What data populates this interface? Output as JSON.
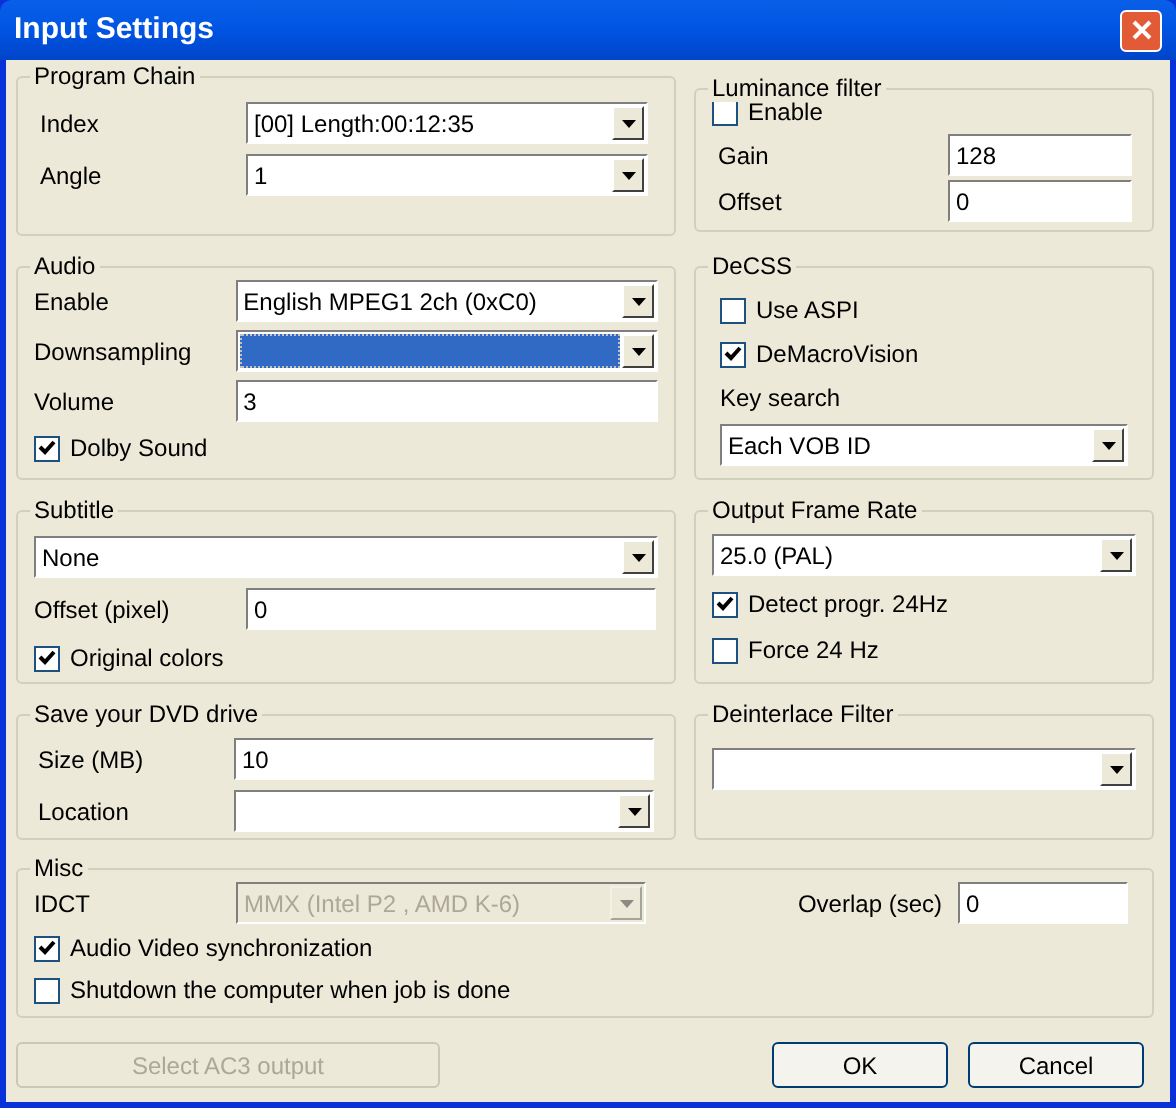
{
  "window": {
    "title": "Input Settings"
  },
  "program_chain": {
    "title": "Program Chain",
    "rows": [
      {
        "kind": "select",
        "label": "Index",
        "value": "[00] Length:00:12:35",
        "disabled": false,
        "focused": false
      },
      {
        "kind": "select",
        "label": "Angle",
        "value": "1",
        "disabled": false,
        "focused": false
      }
    ]
  },
  "audio": {
    "title": "Audio",
    "rows": [
      {
        "kind": "select",
        "label": "Enable",
        "value": "English MPEG1 2ch (0xC0)",
        "disabled": false,
        "focused": false
      },
      {
        "kind": "select",
        "label": "Downsampling",
        "disabled": false,
        "focused": true
      },
      {
        "kind": "input",
        "label": "Volume",
        "value": "3"
      },
      {
        "kind": "checkbox",
        "label": "Dolby Sound",
        "checked": true
      }
    ]
  },
  "subtitle": {
    "title": "Subtitle",
    "rows": [
      {
        "kind": "select",
        "value": "None",
        "disabled": false,
        "focused": false
      },
      {
        "kind": "input",
        "label": "Offset (pixel)",
        "value": "0"
      },
      {
        "kind": "checkbox",
        "label": "Original colors",
        "checked": true
      }
    ]
  },
  "dvd_drive": {
    "title": "Save your DVD drive",
    "rows": [
      {
        "kind": "input",
        "label": "Size (MB)",
        "value": "10"
      },
      {
        "kind": "select",
        "label": "Location",
        "disabled": false,
        "focused": false
      }
    ]
  },
  "luminance": {
    "title": "Luminance filter",
    "rows": [
      {
        "kind": "checkbox",
        "label": "Enable",
        "checked": false
      },
      {
        "kind": "input",
        "label": "Gain",
        "value": "128"
      },
      {
        "kind": "input",
        "label": "Offset",
        "value": "0"
      }
    ]
  },
  "decss": {
    "title": "DeCSS",
    "rows": [
      {
        "kind": "checkbox",
        "label": "Use ASPI",
        "checked": false
      },
      {
        "kind": "checkbox",
        "label": "DeMacroVision",
        "checked": true
      },
      {
        "kind": "text",
        "label": "Key search"
      },
      {
        "kind": "select",
        "value": "Each VOB ID",
        "disabled": false,
        "focused": false
      }
    ]
  },
  "frame_rate": {
    "title": "Output Frame Rate",
    "rows": [
      {
        "kind": "select",
        "value": "25.0  (PAL)",
        "disabled": false,
        "focused": false
      },
      {
        "kind": "checkbox",
        "label": "Detect progr. 24Hz",
        "checked": true
      },
      {
        "kind": "checkbox",
        "label": "Force 24 Hz",
        "checked": false
      }
    ]
  },
  "deinterlace": {
    "title": "Deinterlace Filter",
    "rows": [
      {
        "kind": "select",
        "disabled": false,
        "focused": false
      }
    ]
  },
  "misc": {
    "title": "Misc",
    "idct": {
      "label": "IDCT",
      "value": "MMX (Intel P2 , AMD K-6)",
      "disabled": true,
      "focused": false
    },
    "overlap": {
      "label": "Overlap (sec)",
      "value": "0"
    },
    "checks": [
      {
        "label": "Audio Video synchronization",
        "checked": true
      },
      {
        "label": "Shutdown the computer when job is done",
        "checked": false
      }
    ]
  },
  "buttons": [
    {
      "label": "Select AC3 output",
      "disabled": true
    },
    {
      "label": "OK",
      "disabled": false
    },
    {
      "label": "Cancel",
      "disabled": false
    }
  ]
}
